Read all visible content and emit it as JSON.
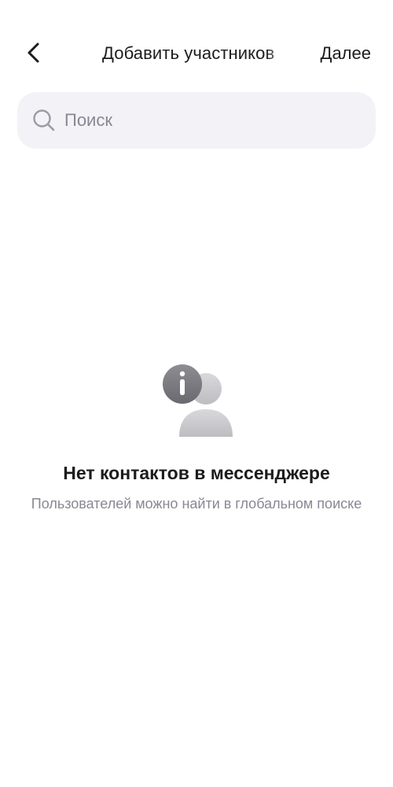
{
  "header": {
    "back_icon": "chevron-left-icon",
    "title": "Добавить участников",
    "next_label": "Далее"
  },
  "search": {
    "icon": "search-icon",
    "placeholder": "Поиск",
    "value": ""
  },
  "empty_state": {
    "icon": "contact-info-icon",
    "title": "Нет контактов в мессенджере",
    "subtitle": "Пользователей можно найти в глобальном поиске"
  },
  "colors": {
    "background": "#ffffff",
    "text_primary": "#1c1c1e",
    "text_secondary": "#8a8794",
    "search_background": "#f3f2f7"
  }
}
